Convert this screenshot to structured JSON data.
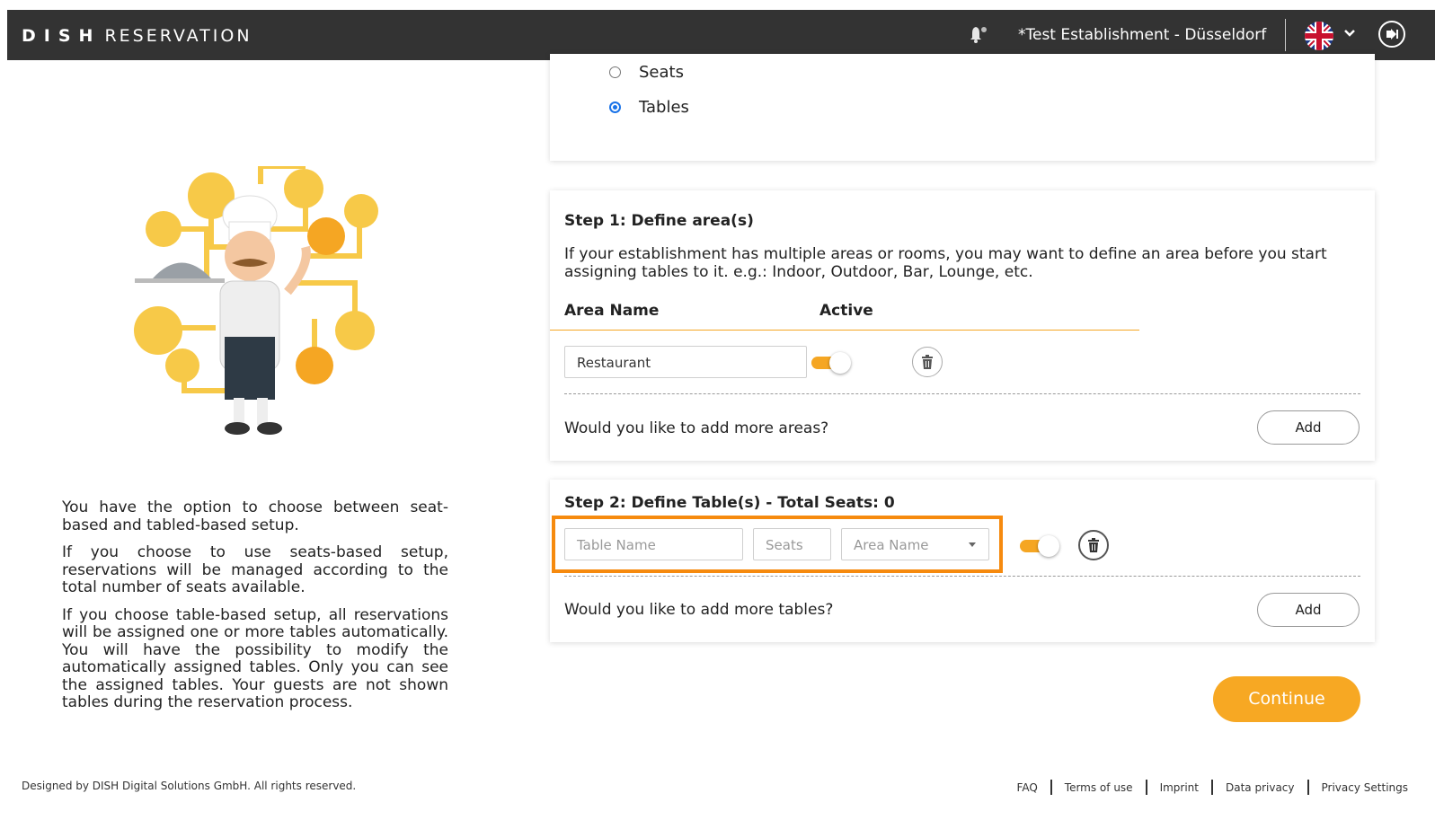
{
  "navbar": {
    "brand_bold": "DISH",
    "brand_light": "RESERVATION",
    "establishment": "*Test Establishment - Düsseldorf"
  },
  "left_panel": {
    "paragraphs": [
      "You have the option to choose between seat-based and tabled-based setup.",
      "If you choose to use seats-based setup, reservations will be managed according to the total number of seats available.",
      "If you choose table-based setup, all reservations will be assigned one or more tables automatically. You will have the possibility to modify the automatically assigned tables. Only you can see the assigned tables. Your guests are not shown tables during the reservation process."
    ]
  },
  "setup_type": {
    "options": [
      "Seats",
      "Tables"
    ],
    "selected": "Tables"
  },
  "step1": {
    "title": "Step 1: Define area(s)",
    "description": "If your establishment has multiple areas or rooms, you may want to define an area before you start assigning tables to it. e.g.: Indoor, Outdoor, Bar, Lounge, etc.",
    "col_area_name": "Area Name",
    "col_active": "Active",
    "area_value": "Restaurant",
    "more_question": "Would you like to add more areas?",
    "add_label": "Add"
  },
  "step2": {
    "title": "Step 2: Define Table(s) - Total Seats: 0",
    "table_name_placeholder": "Table Name",
    "seats_placeholder": "Seats",
    "area_placeholder": "Area Name",
    "more_question": "Would you like to add more tables?",
    "add_label": "Add"
  },
  "continue_label": "Continue",
  "footer": {
    "copyright": "Designed by DISH Digital Solutions GmbH. All rights reserved.",
    "links": [
      "FAQ",
      "Terms of use",
      "Imprint",
      "Data privacy",
      "Privacy Settings"
    ]
  },
  "colors": {
    "accent": "#f7a823",
    "highlight": "#f68a0e",
    "navbar": "#333333"
  },
  "icons": [
    "bell-icon",
    "uk-flag-icon",
    "chevron-down-icon",
    "logout-icon",
    "trash-icon"
  ]
}
